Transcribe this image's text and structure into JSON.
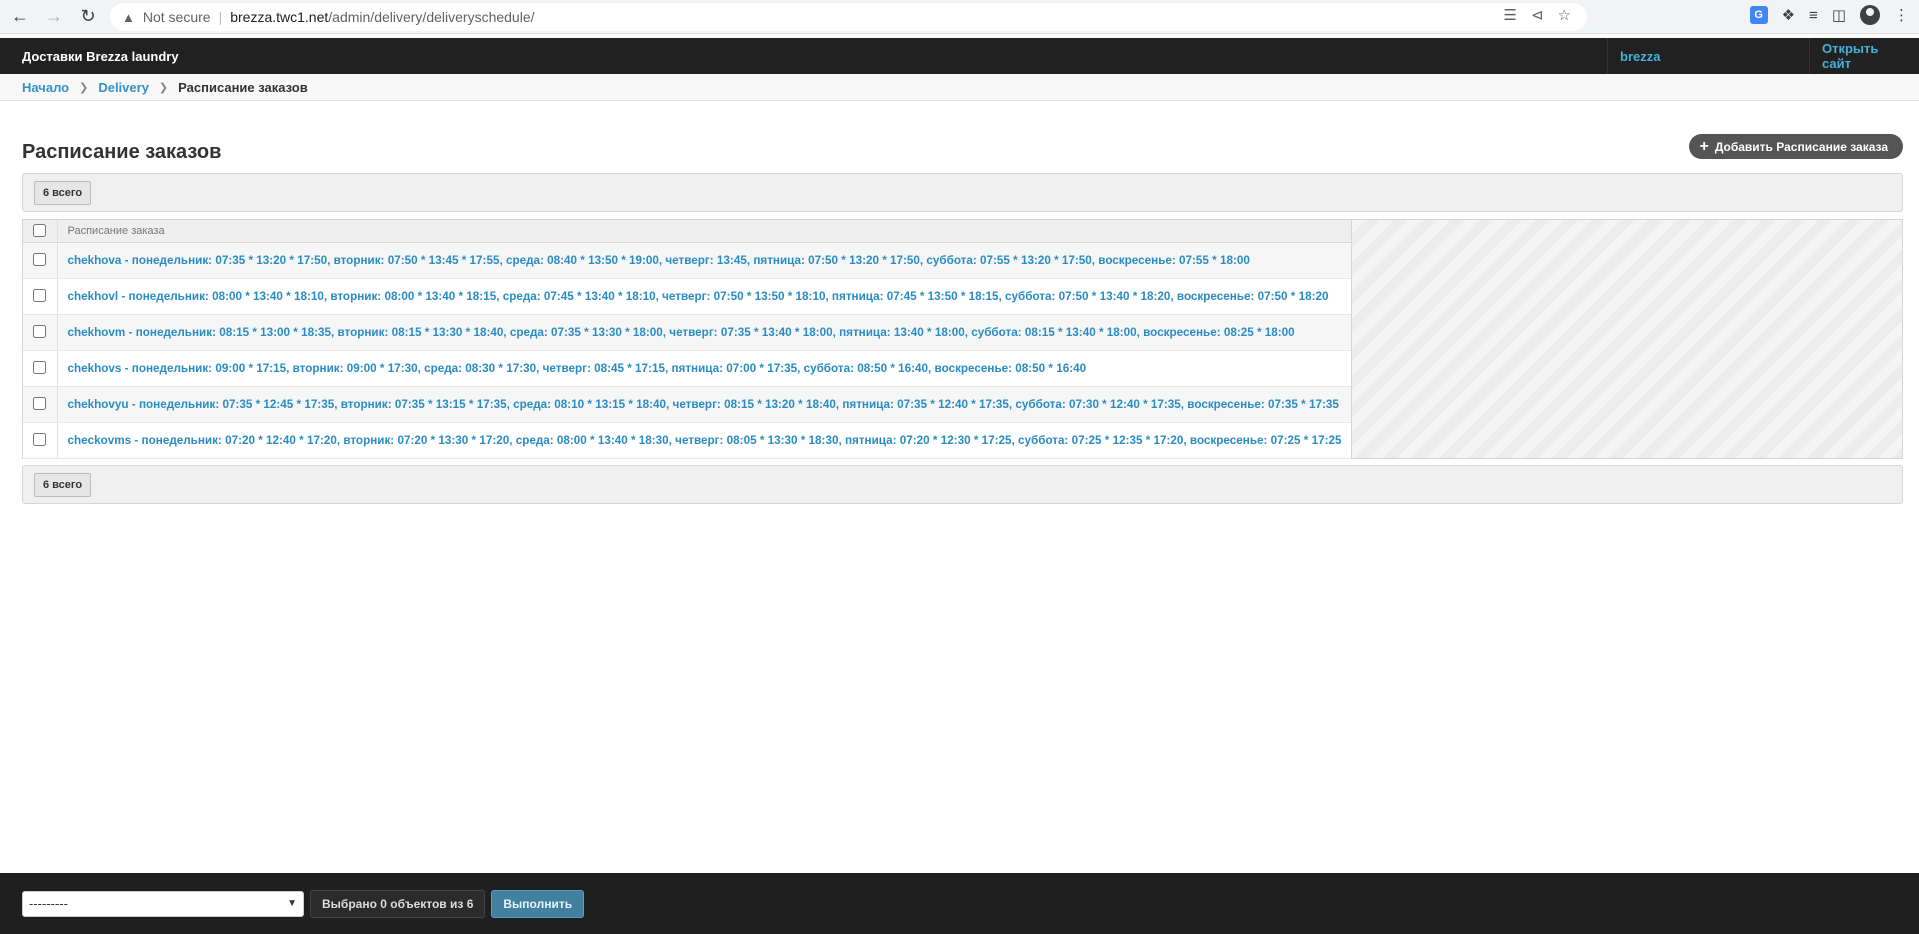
{
  "browser": {
    "security_label": "Not secure",
    "url_host": "brezza.twc1.net",
    "url_path": "/admin/delivery/deliveryschedule/"
  },
  "header": {
    "branding": "Доставки Brezza laundry",
    "user": "brezza",
    "view_site": "Открыть сайт"
  },
  "breadcrumbs": {
    "home": "Начало",
    "app": "Delivery",
    "current": "Расписание заказов"
  },
  "page": {
    "title": "Расписание заказов",
    "add_button": "Добавить Расписание заказа",
    "count_top": "6 всего",
    "count_bottom": "6 всего"
  },
  "table": {
    "column": "Расписание заказа",
    "rows": [
      "chekhova - понедельник: 07:35 * 13:20 * 17:50, вторник: 07:50 * 13:45 * 17:55, среда: 08:40 * 13:50 * 19:00, четверг: 13:45, пятница: 07:50 * 13:20 * 17:50, суббота: 07:55 * 13:20 * 17:50, воскресенье: 07:55 * 18:00",
      "chekhovl - понедельник: 08:00 * 13:40 * 18:10, вторник: 08:00 * 13:40 * 18:15, среда: 07:45 * 13:40 * 18:10, четверг: 07:50 * 13:50 * 18:10, пятница: 07:45 * 13:50 * 18:15, суббота: 07:50 * 13:40 * 18:20, воскресенье: 07:50 * 18:20",
      "chekhovm - понедельник: 08:15 * 13:00 * 18:35, вторник: 08:15 * 13:30 * 18:40, среда: 07:35 * 13:30 * 18:00, четверг: 07:35 * 13:40 * 18:00, пятница: 13:40 * 18:00, суббота: 08:15 * 13:40 * 18:00, воскресенье: 08:25 * 18:00",
      "chekhovs - понедельник: 09:00 * 17:15, вторник: 09:00 * 17:30, среда: 08:30 * 17:30, четверг: 08:45 * 17:15, пятница: 07:00 * 17:35, суббота: 08:50 * 16:40, воскресенье: 08:50 * 16:40",
      "chekhovyu - понедельник: 07:35 * 12:45 * 17:35, вторник: 07:35 * 13:15 * 17:35, среда: 08:10 * 13:15 * 18:40, четверг: 08:15 * 13:20 * 18:40, пятница: 07:35 * 12:40 * 17:35, суббота: 07:30 * 12:40 * 17:35, воскресенье: 07:35 * 17:35",
      "checkovms - понедельник: 07:20 * 12:40 * 17:20, вторник: 07:20 * 13:30 * 17:20, среда: 08:00 * 13:40 * 18:30, четверг: 08:05 * 13:30 * 18:30, пятница: 07:20 * 12:30 * 17:25, суббота: 07:25 * 12:35 * 17:20, воскресенье: 07:25 * 17:25"
    ]
  },
  "actions": {
    "select_value": "---------",
    "selected_counter": "Выбрано 0 объектов из 6",
    "run_button": "Выполнить"
  }
}
